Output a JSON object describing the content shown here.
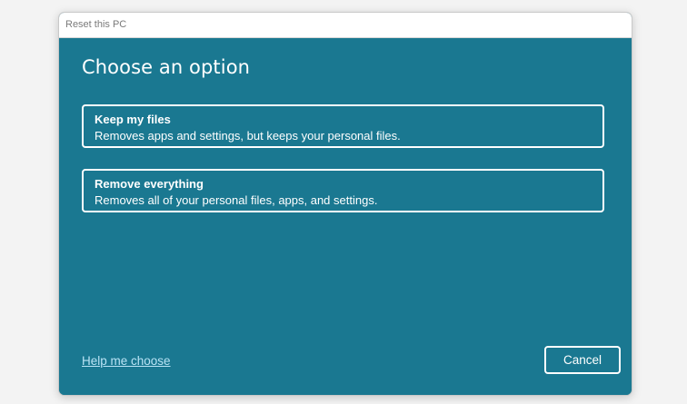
{
  "window": {
    "title": "Reset this PC"
  },
  "main": {
    "heading": "Choose an option",
    "options": [
      {
        "title": "Keep my files",
        "description": "Removes apps and settings, but keeps your personal files."
      },
      {
        "title": "Remove everything",
        "description": "Removes all of your personal files, apps, and settings."
      }
    ]
  },
  "footer": {
    "help_link": "Help me choose",
    "cancel_label": "Cancel"
  },
  "colors": {
    "background": "#1a7891",
    "text": "#ffffff",
    "link": "#b9e3f5"
  }
}
